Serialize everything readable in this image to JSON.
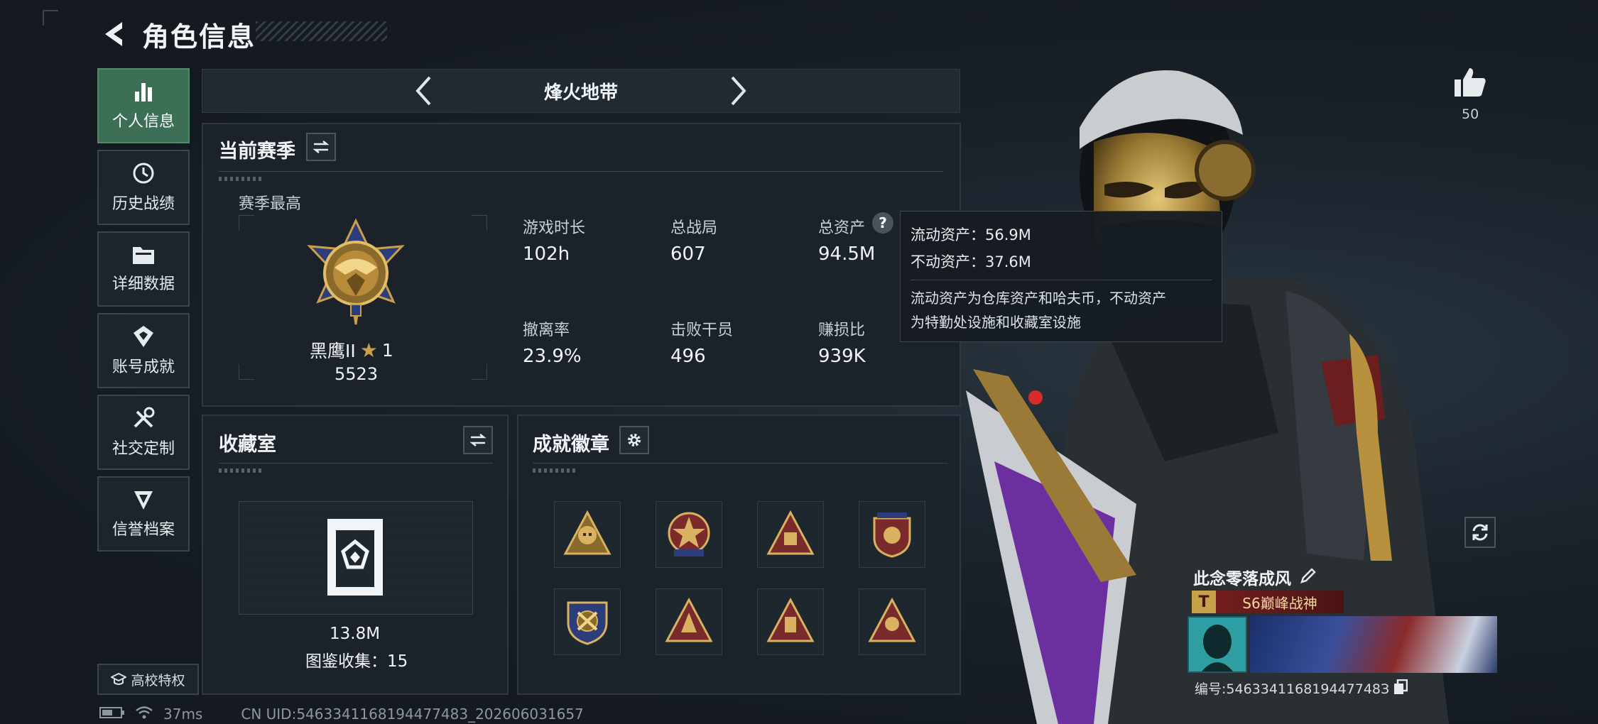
{
  "header": {
    "title": "角色信息"
  },
  "side_nav": [
    {
      "label": "个人信息",
      "icon": "bar-chart-icon",
      "active": true
    },
    {
      "label": "历史战绩",
      "icon": "history-clock-icon"
    },
    {
      "label": "详细数据",
      "icon": "folder-icon"
    },
    {
      "label": "账号成就",
      "icon": "achievement-icon"
    },
    {
      "label": "社交定制",
      "icon": "tools-icon"
    },
    {
      "label": "信誉档案",
      "icon": "shield-badge-icon"
    }
  ],
  "campus_button": {
    "label": "高校特权"
  },
  "mode": {
    "title": "烽火地带"
  },
  "season": {
    "title": "当前赛季",
    "best_label": "赛季最高",
    "rank_name": "黑鹰II",
    "rank_stars": "1",
    "rank_score": "5523",
    "stats": [
      {
        "label": "游戏时长",
        "value": "102h"
      },
      {
        "label": "总战局",
        "value": "607"
      },
      {
        "label": "总资产",
        "value": "94.5M"
      },
      {
        "label": "撤离率",
        "value": "23.9%"
      },
      {
        "label": "击败干员",
        "value": "496"
      },
      {
        "label": "赚损比",
        "value": "939K"
      }
    ]
  },
  "tooltip": {
    "liquid": "流动资产：56.9M",
    "fixed": "不动资产：37.6M",
    "desc_line1": "流动资产为仓库资产和哈夫币，不动资产",
    "desc_line2": "为特勤处设施和收藏室设施"
  },
  "collection": {
    "title": "收藏室",
    "value": "13.8M",
    "collected": "图鉴收集：15"
  },
  "achievements": {
    "title": "成就徽章"
  },
  "player": {
    "likes": "50",
    "name": "此念零落成风",
    "rank_title": "S6巅峰战神",
    "id_text": "编号:546334116819447748З"
  },
  "status_bar": {
    "ping": "37ms",
    "uid": "CN UID:5463341168194477483_202606031657"
  },
  "colors": {
    "accent_green": "#3c6f55",
    "gold": "#c9a04a",
    "panel": "#1b2229"
  }
}
